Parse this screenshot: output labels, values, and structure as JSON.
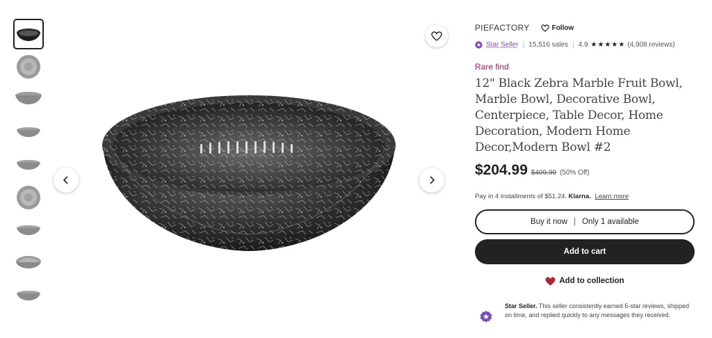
{
  "gallery": {
    "thumbnails": [
      {
        "label": "thumbnail 1",
        "view": "bowl-side",
        "active": true
      },
      {
        "label": "thumbnail 2",
        "view": "bowl-top"
      },
      {
        "label": "thumbnail 3",
        "view": "bowl-side-light"
      },
      {
        "label": "thumbnail 4",
        "view": "bowl-side-small"
      },
      {
        "label": "thumbnail 5",
        "view": "bowl-side-small"
      },
      {
        "label": "thumbnail 6",
        "view": "bowl-top"
      },
      {
        "label": "thumbnail 7",
        "view": "bowl-side-small"
      },
      {
        "label": "thumbnail 8",
        "view": "bowl-angle"
      },
      {
        "label": "thumbnail 9",
        "view": "bowl-side-small"
      }
    ],
    "icons": {
      "prev": "chevron-left-icon",
      "next": "chevron-right-icon",
      "favorite": "heart-outline-icon"
    }
  },
  "shop": {
    "name": "PIEFACTORY",
    "follow_label": "Follow",
    "star_seller_label": "Star Seller",
    "sales": "15,516 sales",
    "rating": "4.9",
    "stars": "★★★★★",
    "reviews": "(4,908 reviews)"
  },
  "listing": {
    "badge": "Rare find",
    "title": "12\" Black Zebra Marble Fruit Bowl, Marble Bowl, Decorative Bowl, Centerpiece, Table Decor, Home Decoration, Modern Home Decor,Modern Bowl #2",
    "price": "$204.99",
    "original_price": "$409.99",
    "discount": "(50% Off)"
  },
  "klarna": {
    "prefix": "Pay in 4 installments of $51.24.",
    "brand": "Klarna.",
    "link": "Learn more"
  },
  "actions": {
    "buy_now": "Buy it now",
    "availability": "Only 1 available",
    "add_to_cart": "Add to cart",
    "add_to_collection": "Add to collection"
  },
  "star_seller_note": {
    "heading": "Star Seller.",
    "body": "This seller consistently earned 5-star reviews, shipped on time, and replied quickly to any messages they received."
  },
  "colors": {
    "accent_purple": "#7a4bbd",
    "rare_find": "#a0195b",
    "heart_red": "#b3243a",
    "button_dark": "#222222"
  }
}
